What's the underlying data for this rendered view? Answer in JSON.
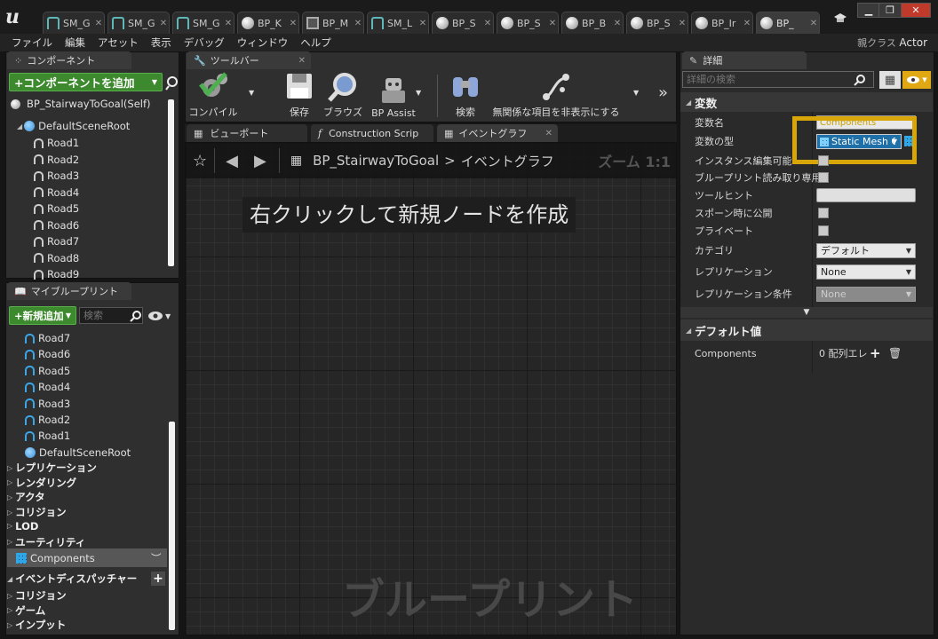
{
  "titlebar": {
    "tabs": [
      {
        "label": "SM_G",
        "icon": "static-mesh-icon"
      },
      {
        "label": "SM_G",
        "icon": "static-mesh-icon"
      },
      {
        "label": "SM_G",
        "icon": "static-mesh-icon"
      },
      {
        "label": "BP_K",
        "icon": "blueprint-icon"
      },
      {
        "label": "BP_M",
        "icon": "map-icon"
      },
      {
        "label": "SM_L",
        "icon": "static-mesh-icon"
      },
      {
        "label": "BP_S",
        "icon": "blueprint-icon"
      },
      {
        "label": "BP_S",
        "icon": "blueprint-icon"
      },
      {
        "label": "BP_B",
        "icon": "blueprint-icon"
      },
      {
        "label": "BP_S",
        "icon": "blueprint-icon"
      },
      {
        "label": "BP_Ir",
        "icon": "blueprint-icon"
      },
      {
        "label": "BP_",
        "icon": "blueprint-icon"
      }
    ],
    "window_buttons": [
      "▁",
      "❐",
      "✕"
    ]
  },
  "menubar": {
    "items": [
      "ファイル",
      "編集",
      "アセット",
      "表示",
      "デバッグ",
      "ウィンドウ",
      "ヘルプ"
    ],
    "parent_class_label": "親クラス",
    "parent_class_value": "Actor"
  },
  "components_panel": {
    "tab_label": "コンポーネント",
    "add_button_label": "+コンポーネントを追加",
    "self_item": "BP_StairwayToGoal(Self)",
    "root_item": "DefaultSceneRoot",
    "items": [
      "Road1",
      "Road2",
      "Road3",
      "Road4",
      "Road5",
      "Road6",
      "Road7",
      "Road8",
      "Road9"
    ]
  },
  "myblueprint_panel": {
    "tab_label": "マイブループリント",
    "add_new_label": "+新規追加",
    "search_placeholder": "検索",
    "variables": [
      "Road7",
      "Road6",
      "Road5",
      "Road4",
      "Road3",
      "Road2",
      "Road1",
      "DefaultSceneRoot"
    ],
    "categories": [
      "レプリケーション",
      "レンダリング",
      "アクタ",
      "コリジョン",
      "LOD",
      "ユーティリティ"
    ],
    "selected_variable": "Components",
    "event_dispatchers_label": "イベントディスパッチャー",
    "bottom_categories": [
      "コリジョン",
      "ゲーム",
      "インプット"
    ]
  },
  "toolbar": {
    "tab_label": "ツールバー",
    "buttons": [
      "コンパイル",
      "保存",
      "ブラウズ",
      "BP Assist",
      "検索",
      "無関係な項目を非表示にする"
    ]
  },
  "graph": {
    "tabs": [
      "ビューポート",
      "Construction Scrip",
      "イベントグラフ"
    ],
    "breadcrumb_bp": "BP_StairwayToGoal",
    "breadcrumb_sep": ">",
    "breadcrumb_graph": "イベントグラフ",
    "zoom_label": "ズーム 1:1",
    "hint": "右クリックして新規ノードを作成",
    "watermark": "ブループリント"
  },
  "details": {
    "tab_label": "詳細",
    "search_placeholder": "詳細の検索",
    "section_variable": "変数",
    "var_name_label": "変数名",
    "var_name_value": "Components",
    "var_type_label": "変数の型",
    "var_type_value": "Static Mesh Co",
    "instance_editable_label": "インスタンス編集可能",
    "bp_readonly_label": "ブループリント読み取り専用",
    "tooltip_label": "ツールヒント",
    "expose_spawn_label": "スポーン時に公開",
    "private_label": "プライベート",
    "category_label": "カテゴリ",
    "category_value": "デフォルト",
    "replication_label": "レプリケーション",
    "replication_value": "None",
    "replication_cond_label": "レプリケーション条件",
    "replication_cond_value": "None",
    "section_default": "デフォルト値",
    "default_comp_label": "Components",
    "default_comp_value": "0 配列エレ"
  },
  "colors": {
    "accent_green": "#3d8a2e",
    "highlight_box": "#d9a60a",
    "eye_button": "#e0a812"
  }
}
